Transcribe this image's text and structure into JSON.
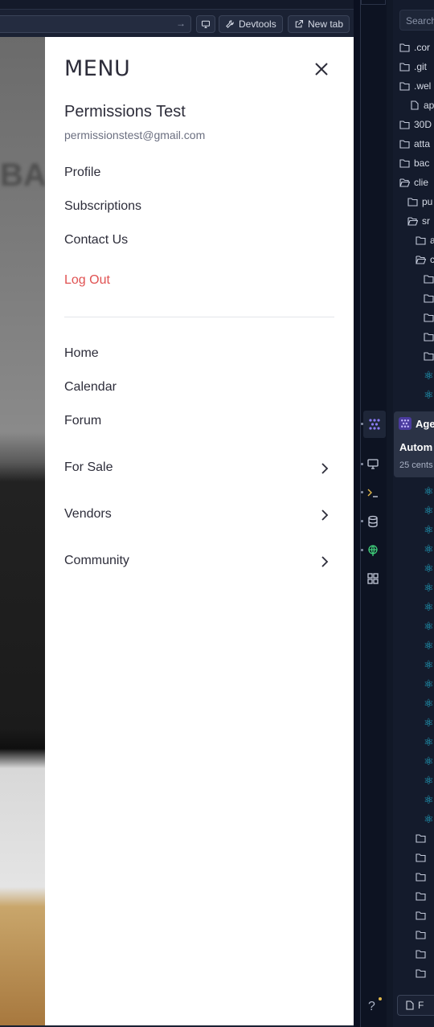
{
  "browser_toolbar": {
    "devtools_label": "Devtools",
    "new_tab_label": "New tab"
  },
  "menu": {
    "logo_text": "MENU",
    "user_name": "Permissions Test",
    "user_email": "permissionstest@gmail.com",
    "account_items": [
      {
        "label": "Profile"
      },
      {
        "label": "Subscriptions"
      },
      {
        "label": "Contact Us"
      }
    ],
    "logout_label": "Log Out",
    "nav_items": [
      {
        "label": "Home"
      },
      {
        "label": "Calendar"
      },
      {
        "label": "Forum"
      },
      {
        "label": "For Sale"
      },
      {
        "label": "Vendors"
      },
      {
        "label": "Community"
      }
    ]
  },
  "ide": {
    "search_placeholder": "Search",
    "tree": [
      {
        "name": ".cor",
        "kind": "folder"
      },
      {
        "name": ".git",
        "kind": "folder"
      },
      {
        "name": ".wel",
        "kind": "folder"
      },
      {
        "name": "ap",
        "kind": "file"
      },
      {
        "name": "30D",
        "kind": "folder"
      },
      {
        "name": "atta",
        "kind": "folder"
      },
      {
        "name": "bac",
        "kind": "folder"
      },
      {
        "name": "clie",
        "kind": "folder-open"
      },
      {
        "name": "pu",
        "kind": "folder"
      },
      {
        "name": "sr",
        "kind": "folder-open"
      },
      {
        "name": "a",
        "kind": "folder"
      },
      {
        "name": "c",
        "kind": "folder-open"
      }
    ],
    "agent_popup": {
      "name": "Age",
      "title": "Autom",
      "cost": "25 cents"
    },
    "help_label": "?",
    "bottom_file_label": "F",
    "colors": {
      "accent": "#6c5ce7",
      "react": "#22b6d6",
      "logout": "#e05252"
    }
  }
}
